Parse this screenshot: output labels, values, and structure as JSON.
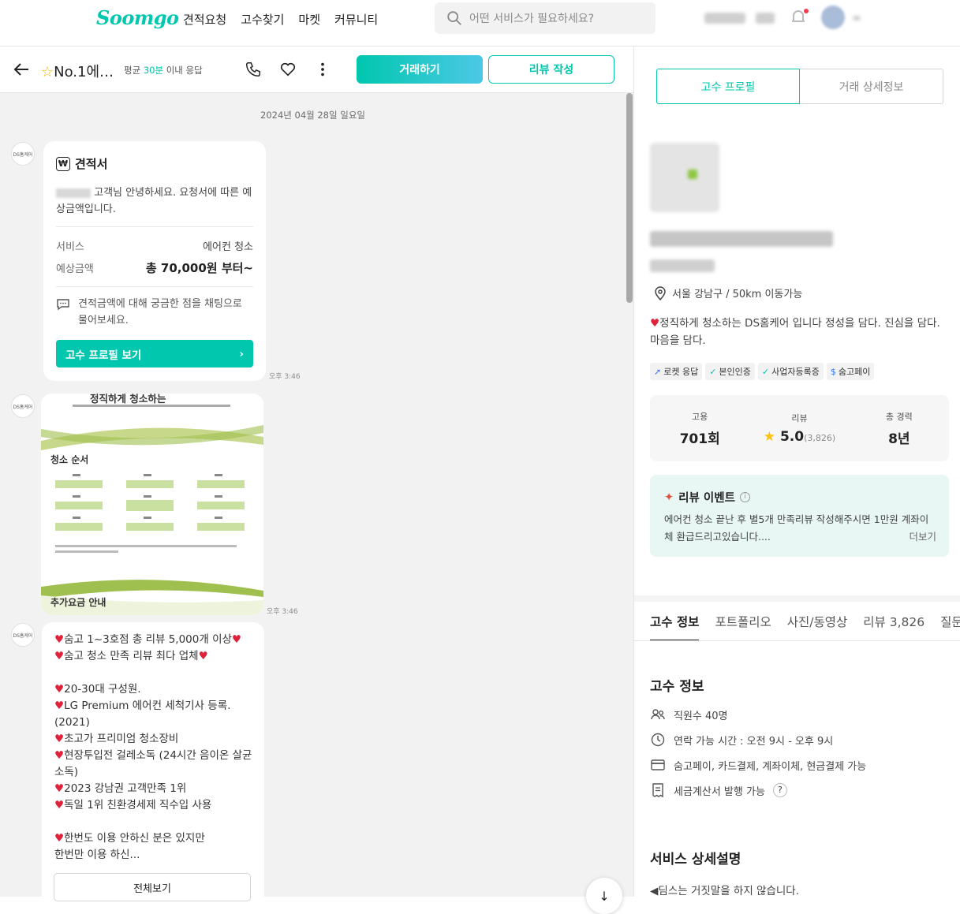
{
  "nav": {
    "logo": "Soomgo",
    "links": [
      "견적요청",
      "고수찾기",
      "마켓",
      "커뮤니티"
    ],
    "search_placeholder": "어떤 서비스가 필요하세요?"
  },
  "chat_header": {
    "name": "No.1에…",
    "response_prefix": "평균",
    "response_time": "30분",
    "response_suffix": "이내 응답",
    "deal_button": "거래하기",
    "review_button": "리뷰 작성"
  },
  "chat": {
    "date": "2024년 04월 28일 일요일",
    "avatar_text": "DS홈케어",
    "quote": {
      "title": "견적서",
      "greeting": "고객님 안녕하세요. 요청서에 따른 예상금액입니다.",
      "service_label": "서비스",
      "service_value": "에어컨 청소",
      "price_label": "예상금액",
      "price_value": "총 70,000원 부터~",
      "note": "견적금액에 대해 궁금한 점을 채팅으로 물어보세요.",
      "profile_button": "고수 프로필 보기",
      "time": "오후 3:46"
    },
    "image_message": {
      "top_text": "정직하게 청소하는",
      "section1": "청소 순서",
      "section2": "추가요금 안내",
      "time": "오후 3:46"
    },
    "text_message": {
      "lines": [
        "숨고 1~3호점 총 리뷰 5,000개 이상",
        "숨고 청소 만족 리뷰 최다 업체",
        "",
        "20-30대 구성원.",
        "LG Premium 에어컨 세척기사 등록.(2021)",
        "초고가 프리미엄 청소장비",
        "현장투입전 걸레소독 (24시간 음이온 살균소독)",
        "2023 강남권 고객만족 1위",
        "독일 1위 친환경세제 직수입 사용",
        "",
        "한번도 이용 안하신 분은 있지만",
        "한번만 이용 하신..."
      ],
      "more_button": "전체보기"
    }
  },
  "profile": {
    "tab_profile": "고수 프로필",
    "tab_detail": "거래 상세정보",
    "location": "서울 강남구 / 50km 이동가능",
    "intro": "정직하게 청소하는 DS홈케어 입니다 정성을 담다. 진심을 담다. 마음을 담다.",
    "badges": [
      "로켓 응답",
      "본인인증",
      "사업자등록증",
      "숨고페이"
    ],
    "stats": {
      "hire_label": "고용",
      "hire_value": "701회",
      "review_label": "리뷰",
      "rating": "5.0",
      "review_count": "(3,826)",
      "career_label": "총 경력",
      "career_value": "8년"
    },
    "event": {
      "title": "리뷰 이벤트",
      "body": "에어컨 청소 끝난 후 별5개 만족리뷰 작성해주시면 1만원 계좌이체 환급드리고있습니다....",
      "more": "더보기"
    },
    "subtabs": [
      "고수 정보",
      "포트폴리오",
      "사진/동영상",
      "리뷰 3,826",
      "질문"
    ],
    "info_title": "고수 정보",
    "info": [
      "직원수 40명",
      "연락 가능 시간 : 오전 9시 - 오후 9시",
      "숨고페이, 카드결제, 계좌이체, 현금결제 가능",
      "세금계산서 발행 가능"
    ],
    "service_title": "서비스 상세설명",
    "service_first_line": "딤스는 거짓말을 하지 않습니다."
  },
  "colors": {
    "brand": "#00c7ae",
    "heart": "#e0213a"
  }
}
